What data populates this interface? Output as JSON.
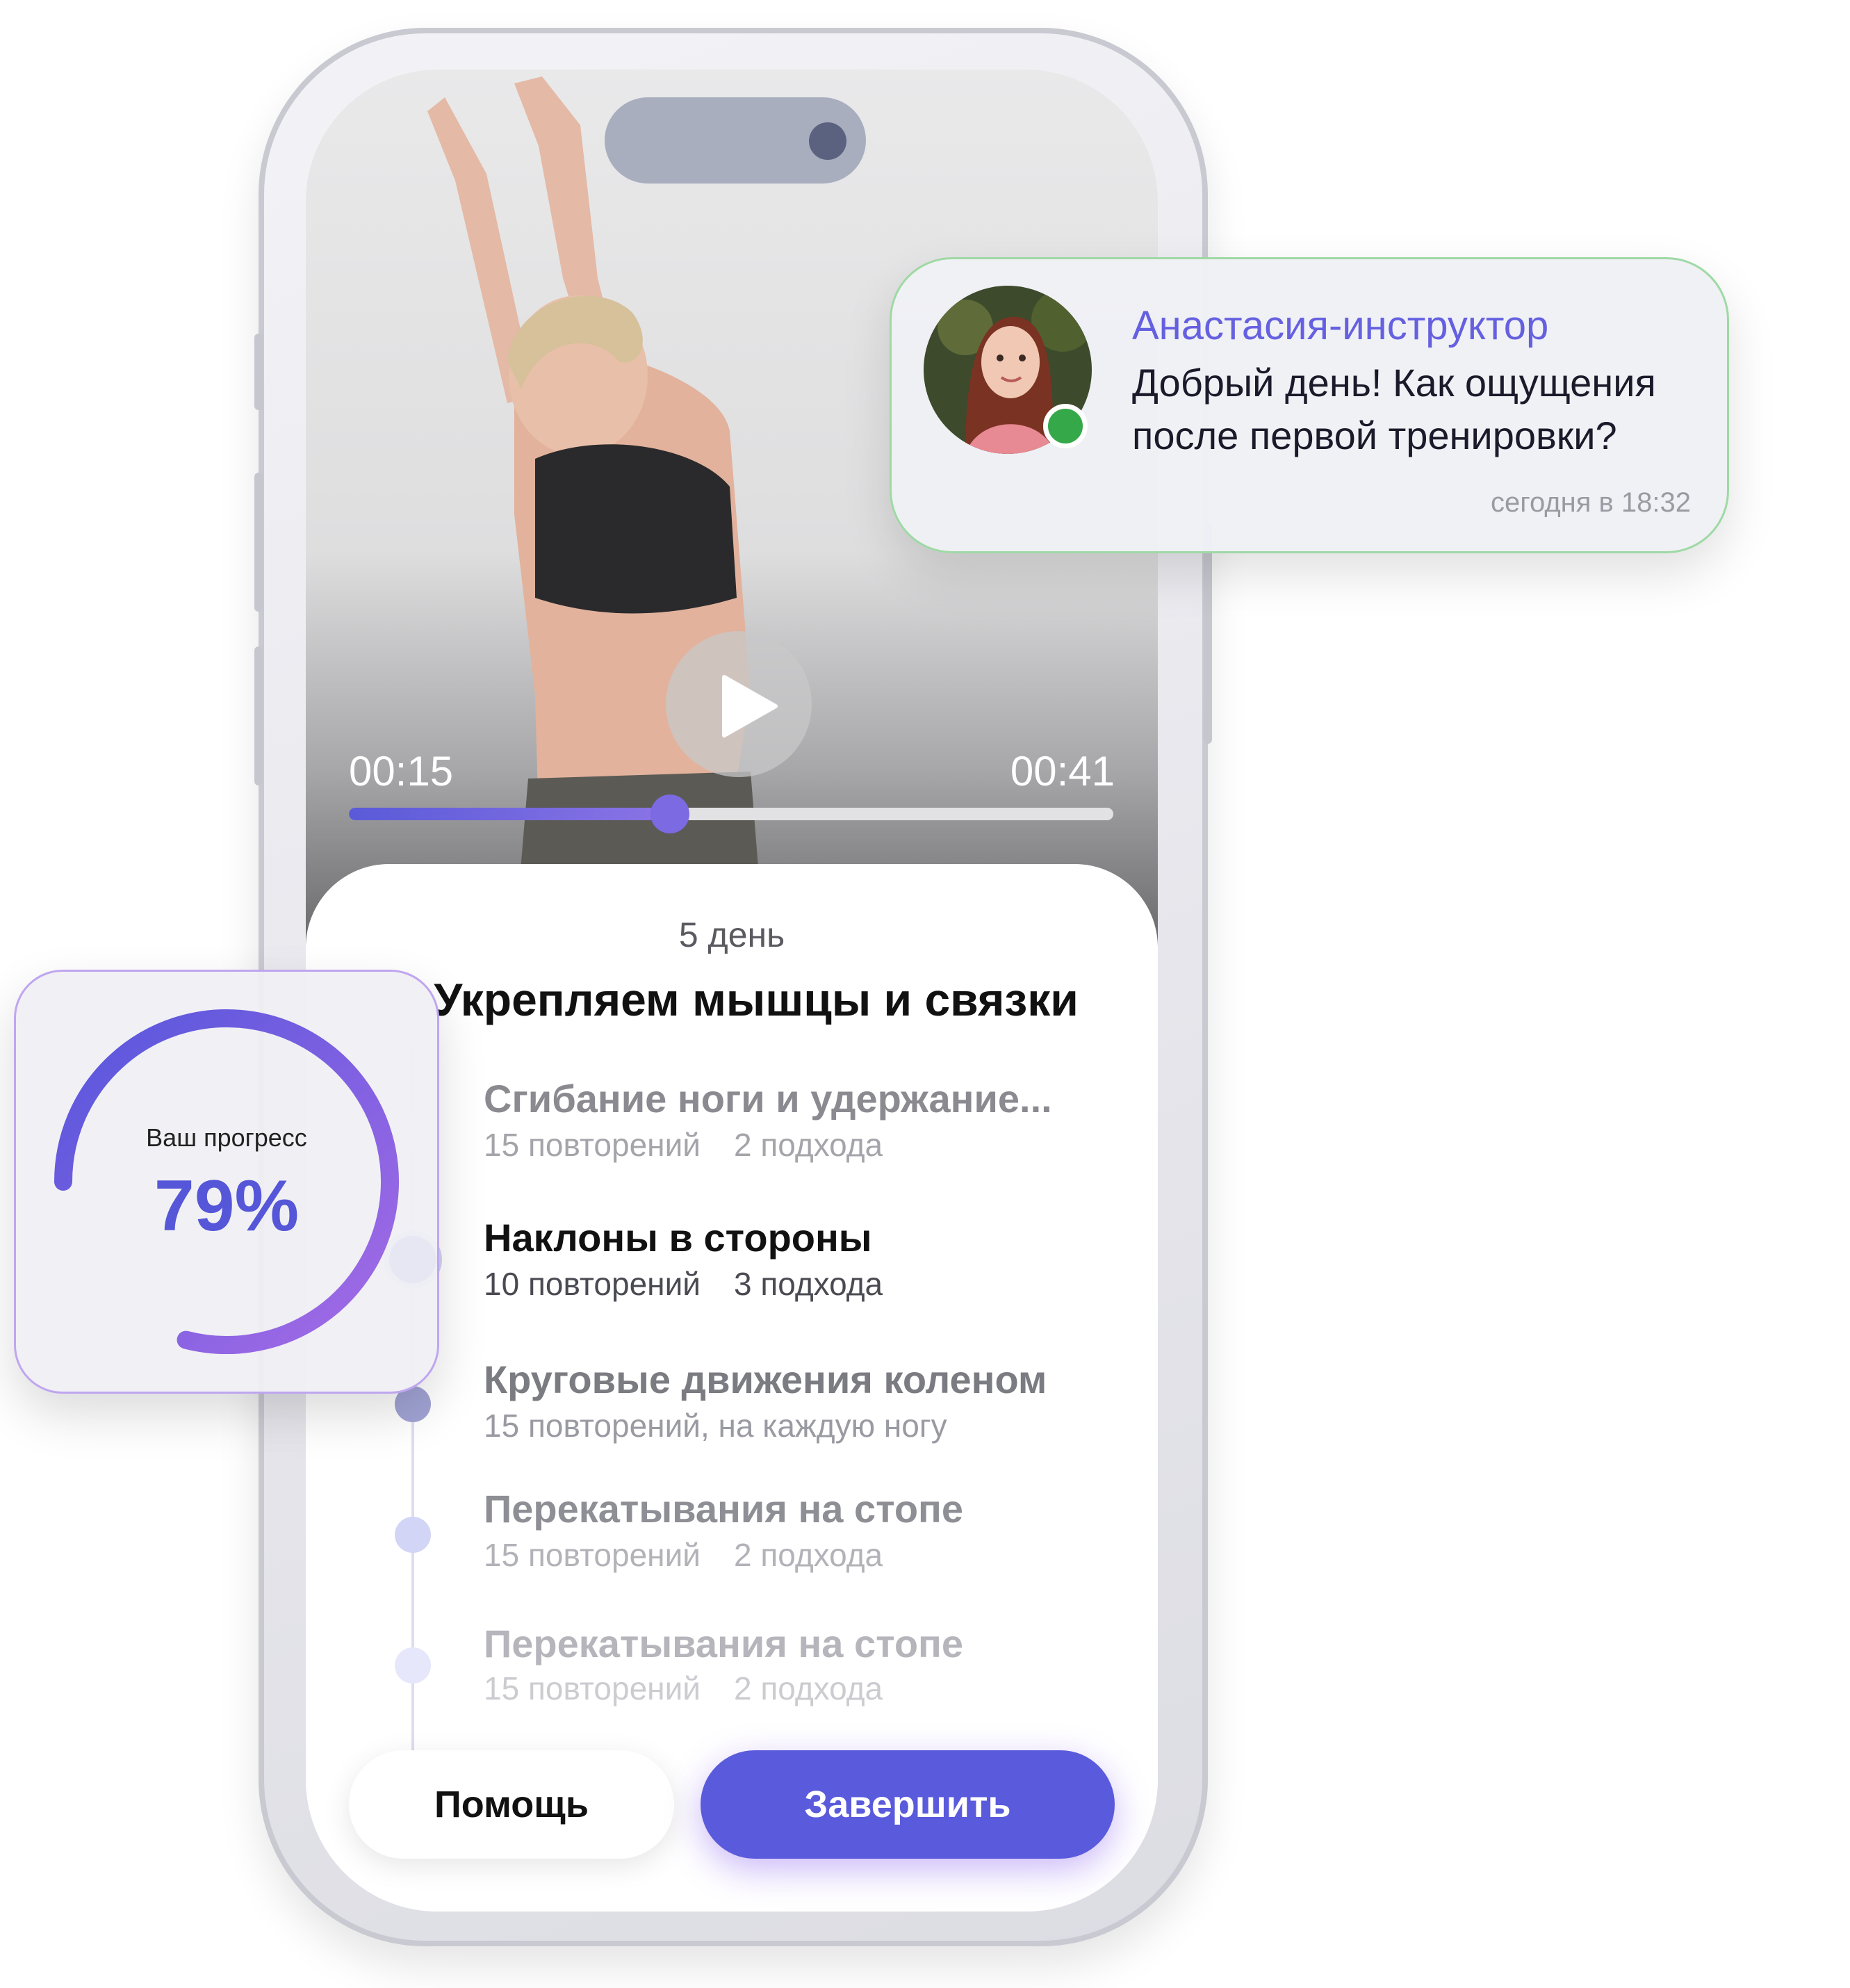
{
  "video": {
    "elapsed": "00:15",
    "duration": "00:41",
    "progress_fraction": 0.42
  },
  "workout": {
    "day_label": "5 день",
    "title": "Укрепляем мышцы и связки",
    "exercises": [
      {
        "name": "Сгибание ноги и удержание...",
        "reps": "15 повторений",
        "sets": "2 подхода",
        "state": "done"
      },
      {
        "name": "Наклоны в стороны",
        "reps": "10 повторений",
        "sets": "3 подхода",
        "state": "current"
      },
      {
        "name": "Круговые движения коленом",
        "reps": "15 повторений, на каждую ногу",
        "sets": "",
        "state": "next"
      },
      {
        "name": "Перекатывания на стопе",
        "reps": "15 повторений",
        "sets": "2 подхода",
        "state": "upcoming"
      },
      {
        "name": "Перекатывания на стопе",
        "reps": "15 повторений",
        "sets": "2 подхода",
        "state": "upcoming-faded"
      }
    ]
  },
  "buttons": {
    "help_label": "Помощь",
    "finish_label": "Завершить"
  },
  "chat": {
    "sender": "Анастасия-инструктор",
    "message": "Добрый день! Как ощущения после первой тренировки?",
    "timestamp": "сегодня в 18:32",
    "status": "online"
  },
  "progress": {
    "label": "Ваш прогресс",
    "value_text": "79%",
    "value": 0.79
  },
  "colors": {
    "accent": "#5a5adc",
    "accent_gradient_end": "#a56be6",
    "online": "#35a849",
    "chat_name": "#6560e0"
  },
  "icons": {
    "play": "play-icon"
  }
}
